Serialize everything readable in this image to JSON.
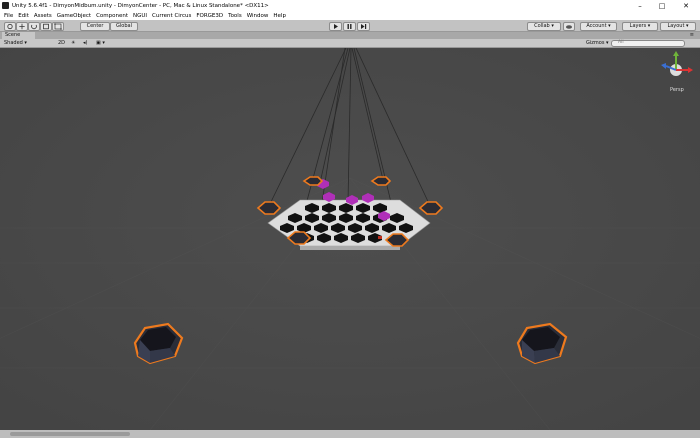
{
  "window": {
    "title": "Unity 5.6.4f1 - DimyonMidbum.unity - DimyonCenter - PC, Mac & Linux Standalone* <DX11>",
    "controls": [
      "–",
      "□",
      "✕"
    ]
  },
  "menu": [
    "File",
    "Edit",
    "Assets",
    "GameObject",
    "Component",
    "NGUI",
    "Current Circus",
    "FORGE3D",
    "Tools",
    "Window",
    "Help"
  ],
  "toolbar": {
    "pivot_label": "Center",
    "space_label": "Global",
    "play_icon": "play-icon",
    "pause_icon": "pause-icon",
    "step_icon": "step-icon",
    "collab_label": "Collab",
    "account_label": "Account",
    "layers_label": "Layers",
    "layout_label": "Layout"
  },
  "scene_tab": {
    "label": "Scene"
  },
  "scene_bar": {
    "shading_mode": "Shaded",
    "mode_2d": "2D",
    "gizmos_label": "Gizmos",
    "search_placeholder": "All"
  },
  "gizmo": {
    "projection_label": "Persp"
  },
  "colors": {
    "viewport_bg": "#484848",
    "selection_outline": "#ee7a1e",
    "accent_purple": "#b02fb8",
    "toolbar_bg": "#c2c2c2"
  }
}
